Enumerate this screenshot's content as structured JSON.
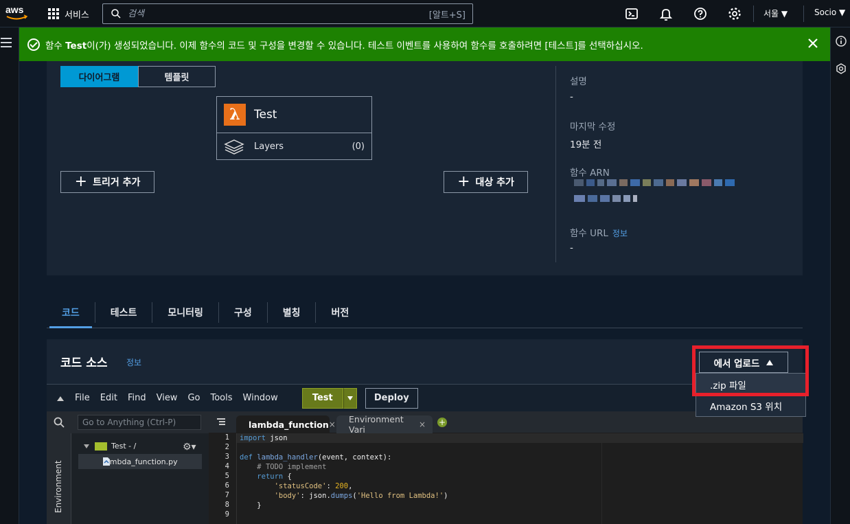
{
  "topnav": {
    "services_label": "서비스",
    "search_placeholder": "검색",
    "search_shortcut": "[알트+S]",
    "region": "서울 ▼",
    "account": "Socio ▼"
  },
  "flash": {
    "message_prefix": "함수 ",
    "message_bold": "Test",
    "message_suffix": "이(가) 생성되었습니다. 이제 함수의 코드 및 구성을 변경할 수 있습니다. 테스트 이벤트를 사용하여 함수를 호출하려면 [테스트]를 선택하십시오."
  },
  "overview": {
    "toggle": [
      "다이어그램",
      "템플릿"
    ],
    "function_name": "Test",
    "layers_label": "Layers",
    "layers_count": "(0)",
    "add_trigger": "트리거 추가",
    "add_destination": "대상 추가",
    "meta": {
      "description_label": "설명",
      "description_value": "-",
      "last_modified_label": "마지막 수정",
      "last_modified_value": "19분 전",
      "arn_label": "함수 ARN",
      "url_label": "함수 URL",
      "url_info": "정보",
      "url_value": "-"
    }
  },
  "tabs": [
    "코드",
    "테스트",
    "모니터링",
    "구성",
    "별칭",
    "버전"
  ],
  "code_source": {
    "title": "코드 소스",
    "info": "정보",
    "upload_button": "에서 업로드",
    "upload_menu": [
      ".zip 파일",
      "Amazon S3 위치"
    ]
  },
  "ide": {
    "menus": [
      "File",
      "Edit",
      "Find",
      "View",
      "Go",
      "Tools",
      "Window"
    ],
    "test_label": "Test",
    "deploy_label": "Deploy",
    "goto_placeholder": "Go to Anything (Ctrl-P)",
    "environment_label": "Environment",
    "folder": "Test - /",
    "file": "lambda_function.py",
    "editor_tabs": [
      "lambda_function",
      "Environment Vari"
    ],
    "line_numbers": [
      "1",
      "2",
      "3",
      "4",
      "5",
      "6",
      "7",
      "8",
      "9"
    ]
  },
  "colors": {
    "flash_bg": "#1d8102",
    "accent": "#539fe5",
    "lambda_orange": "#e8701a",
    "test_green": "#687a1b",
    "highlight_red": "#e8202b"
  }
}
